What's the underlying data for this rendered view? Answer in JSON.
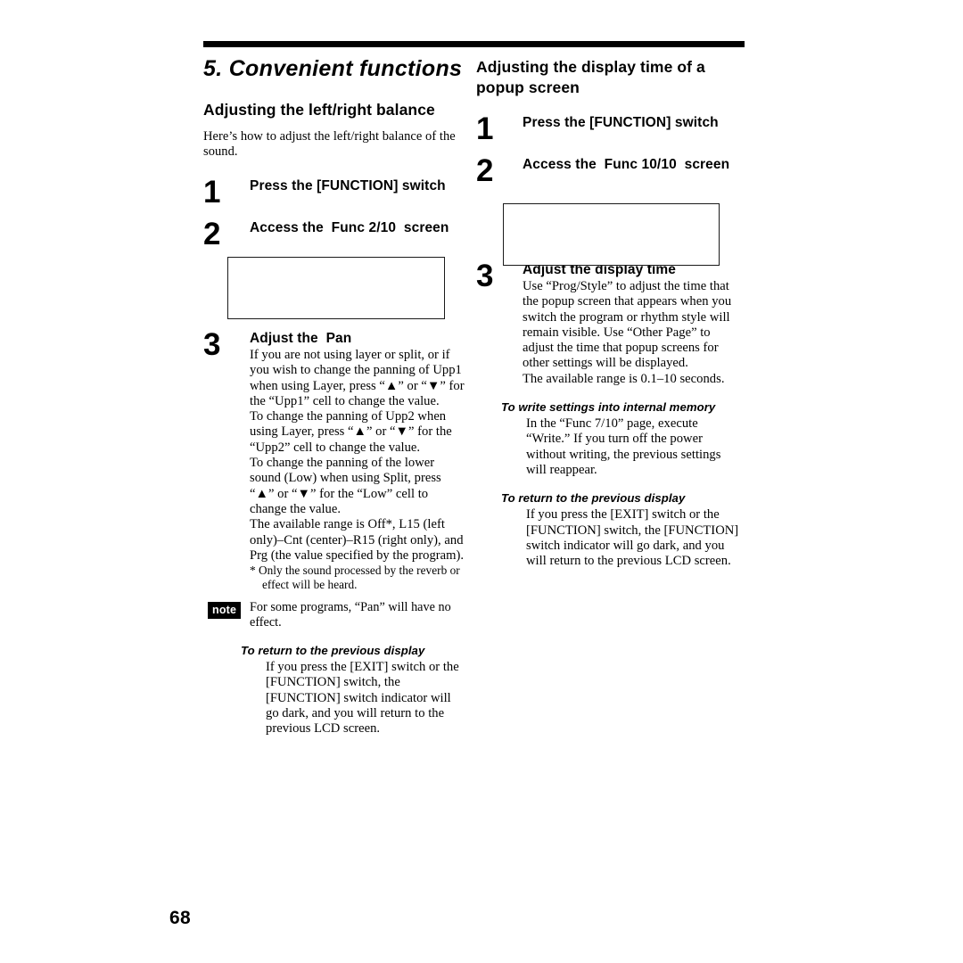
{
  "page": {
    "number": "68",
    "chapter_title": "5. Convenient functions"
  },
  "left_column": {
    "section_title": "Adjusting the left/right balance",
    "intro": "Here’s how to adjust the left/right balance of the sound.",
    "steps": [
      {
        "number": "1",
        "heading": "Press the [FUNCTION] switch"
      },
      {
        "number": "2",
        "heading": "Access the  Func 2/10  screen"
      },
      {
        "number": "3",
        "heading": "Adjust the  Pan",
        "body": "If you are not using layer or split, or if you wish to change the panning of Upp1 when using Layer, press “▲” or “▼” for the “Upp1” cell to change the value.\nTo change the panning of Upp2 when using Layer, press “▲” or “▼” for the “Upp2” cell to change the value.\nTo change the panning of the lower sound (Low) when using Split, press “▲” or “▼” for the “Low” cell to change the value.\nThe available range is Off*, L15 (left only)–Cnt (center)–R15 (right only), and Prg (the value specified by the program).",
        "footnote": "*  Only the sound processed by the reverb or effect will be heard."
      }
    ],
    "note": {
      "badge": "note",
      "text": "For some programs, “Pan” will have no effect."
    },
    "subblocks": [
      {
        "title": "To return to the previous display",
        "body": "If you press the [EXIT] switch or the [FUNCTION] switch, the [FUNCTION] switch indicator will go dark, and you will return to the previous LCD screen."
      }
    ]
  },
  "right_column": {
    "section_title": "Adjusting the display time of a popup screen",
    "steps": [
      {
        "number": "1",
        "heading": "Press the [FUNCTION] switch"
      },
      {
        "number": "2",
        "heading": "Access the  Func 10/10  screen"
      },
      {
        "number": "3",
        "heading": "Adjust the display time",
        "body": "Use “Prog/Style” to adjust the time that the popup screen that appears when you switch the program or rhythm style will remain visible. Use “Other Page” to adjust the time that popup screens for other settings will be displayed.\nThe available range is 0.1–10 seconds."
      }
    ],
    "subblocks": [
      {
        "title": "To write settings into internal memory",
        "body": "In the “Func 7/10” page, execute “Write.” If you turn off the power without writing, the previous settings will reappear."
      },
      {
        "title": "To return to the previous display",
        "body": "If you press the [EXIT] switch or the [FUNCTION] switch, the [FUNCTION] switch indicator will go dark, and you will return to the previous LCD screen."
      }
    ]
  }
}
